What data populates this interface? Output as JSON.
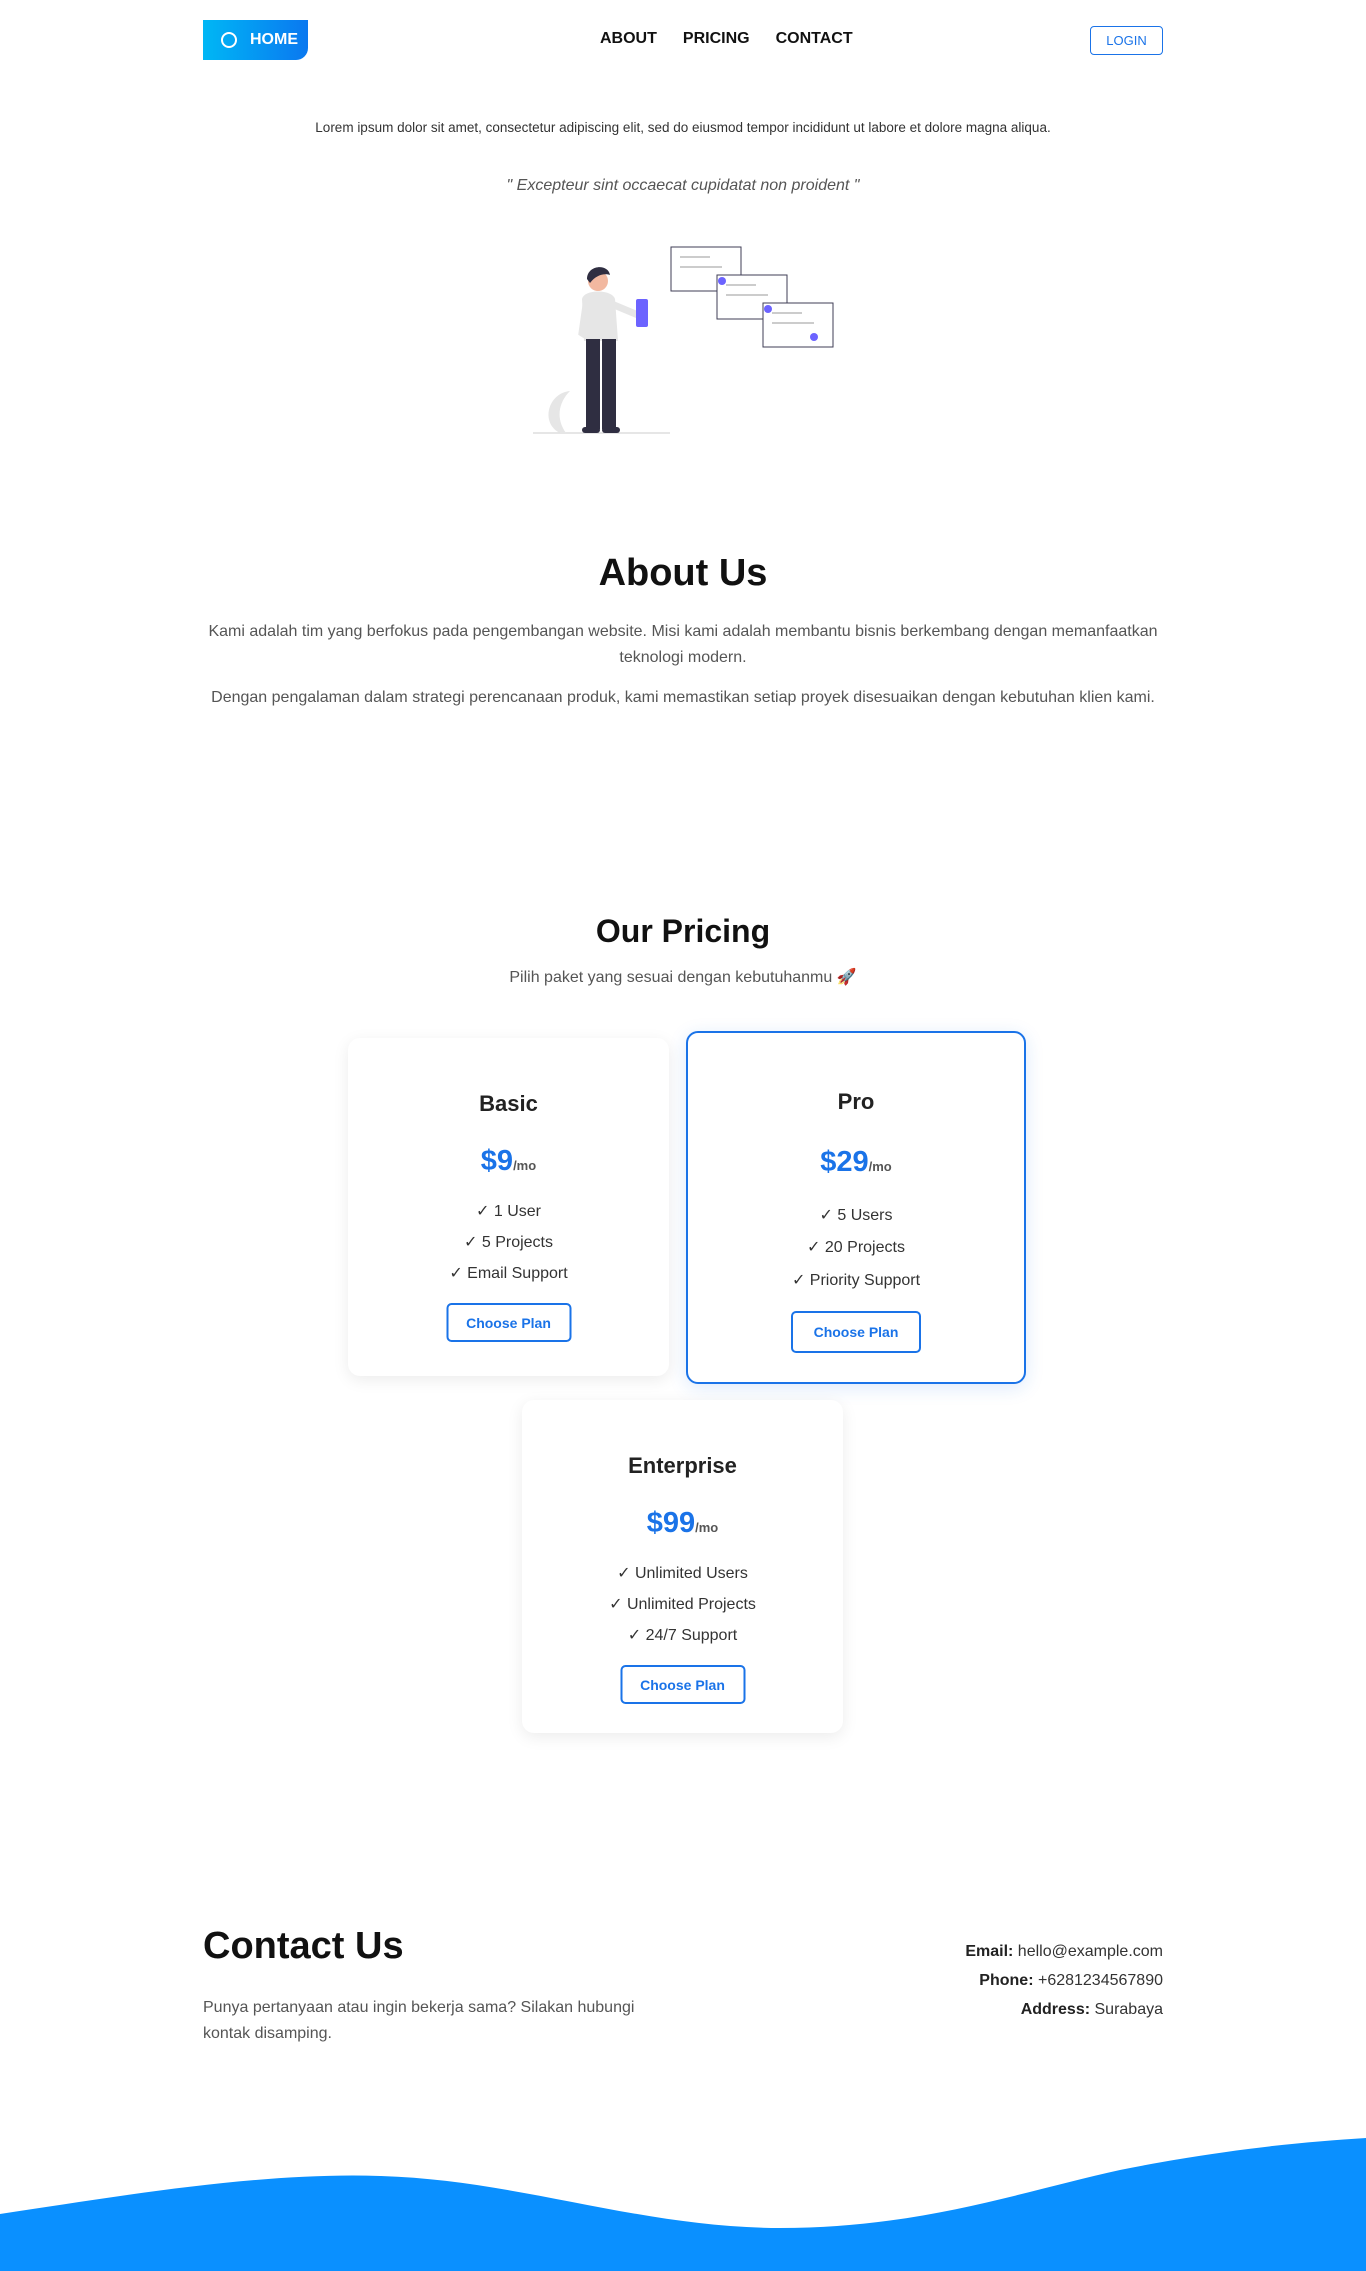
{
  "nav": {
    "home_label": "HOME",
    "links": [
      "ABOUT",
      "PRICING",
      "CONTACT"
    ],
    "login_label": "LOGIN"
  },
  "hero": {
    "text": "Lorem ipsum dolor sit amet, consectetur adipiscing elit, sed do eiusmod tempor incididunt ut labore et dolore magna aliqua.",
    "quote": "\" Excepteur sint occaecat cupidatat non proident \""
  },
  "about": {
    "title": "About Us",
    "p1": "Kami adalah tim yang berfokus pada pengembangan website. Misi kami adalah membantu bisnis berkembang dengan memanfaatkan teknologi modern.",
    "p2": "Dengan pengalaman dalam strategi perencanaan produk, kami memastikan setiap proyek disesuaikan dengan kebutuhan klien kami."
  },
  "pricing": {
    "title": "Our Pricing",
    "subtitle": "Pilih paket yang sesuai dengan kebutuhanmu 🚀",
    "plans": [
      {
        "name": "Basic",
        "price": "$9",
        "per": "/mo",
        "features": [
          "✓ 1 User",
          "✓ 5 Projects",
          "✓ Email Support"
        ],
        "cta": "Choose Plan"
      },
      {
        "name": "Pro",
        "price": "$29",
        "per": "/mo",
        "features": [
          "✓ 5 Users",
          "✓ 20 Projects",
          "✓ Priority Support"
        ],
        "cta": "Choose Plan"
      },
      {
        "name": "Enterprise",
        "price": "$99",
        "per": "/mo",
        "features": [
          "✓ Unlimited Users",
          "✓ Unlimited Projects",
          "✓ 24/7 Support"
        ],
        "cta": "Choose Plan"
      }
    ]
  },
  "contact": {
    "title": "Contact Us",
    "desc": "Punya pertanyaan atau ingin bekerja sama? Silakan hubungi kontak disamping.",
    "email_label": "Email:",
    "email": "hello@example.com",
    "phone_label": "Phone:",
    "phone": "+6281234567890",
    "address_label": "Address:",
    "address": "Surabaya"
  },
  "colors": {
    "accent": "#1a73e8",
    "wave": "#0a90ff",
    "illustration": "#6c63ff"
  }
}
